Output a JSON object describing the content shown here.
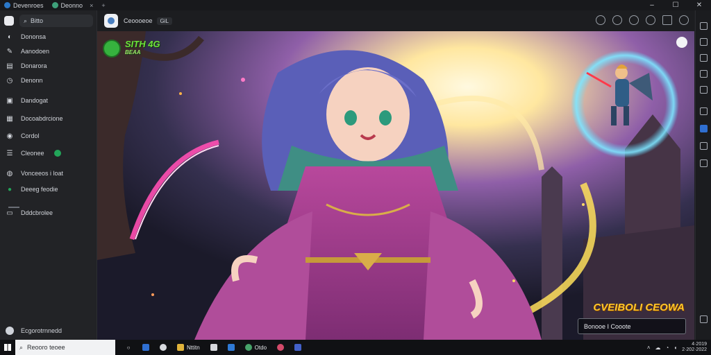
{
  "window": {
    "tabs": [
      {
        "label": "Devenroes"
      },
      {
        "label": "Deonno"
      }
    ],
    "tab_close": "×",
    "tab_new": "+",
    "controls": {
      "minimize": "–",
      "maximize": "☐",
      "close": "✕"
    }
  },
  "sidebar": {
    "search_text": "Bitto",
    "items": [
      {
        "label": "Dononsa",
        "icon": "user-icon"
      },
      {
        "label": "Aanodoen",
        "icon": "pen-icon"
      },
      {
        "label": "Donarora",
        "icon": "folder-icon"
      },
      {
        "label": "Denonn",
        "icon": "clock-icon"
      },
      {
        "label": "Dandogat",
        "icon": "chat-icon"
      },
      {
        "label": "Docoabdrcione",
        "icon": "folder-icon"
      },
      {
        "label": "Cordol",
        "icon": "settings-icon"
      },
      {
        "label": "Cleonee",
        "icon": "list-icon"
      },
      {
        "label": "Vonceeos i loat",
        "icon": "group-icon"
      },
      {
        "label": "Deeeg feodie",
        "icon": "game-icon"
      },
      {
        "label": "Dddcbrolee",
        "icon": "doc-icon"
      }
    ],
    "profile_label": "Ecgorotrnnedd"
  },
  "main_header": {
    "title": "Ceoooeoe",
    "chip": "GiL"
  },
  "artwork": {
    "stream_logo_line1": "SITH 4G",
    "stream_logo_line2": "BEAA",
    "banner_title": "CVEIBOLI CEOWA",
    "caption": "Bonooe I Cooote"
  },
  "taskbar": {
    "search_placeholder": "Reooro teoee",
    "apps": [
      {
        "name": "task-view-icon",
        "color": "#101114"
      },
      {
        "name": "widgets-icon",
        "color": "#2f6fd1"
      },
      {
        "name": "edge-icon",
        "color": "#2a2c31"
      },
      {
        "name": "file-explorer-icon",
        "color": "#e0b33a"
      },
      {
        "name": "store-icon",
        "color": "#2a2c31"
      },
      {
        "name": "vscode-icon",
        "color": "#2f7ad6"
      },
      {
        "name": "discord-icon",
        "color": "#2a2c31"
      },
      {
        "name": "chrome-icon",
        "color": "#2a2c31"
      },
      {
        "name": "teams-icon",
        "color": "#4361c9"
      }
    ],
    "app_labels": {
      "explorer": "Nttitn",
      "discord": "Otdo"
    },
    "clock_time": "4·2019",
    "clock_date": "2·202·2022"
  },
  "colors": {
    "accent": "#2f6fd1",
    "online": "#22a559",
    "banner": "#ffc82a"
  }
}
